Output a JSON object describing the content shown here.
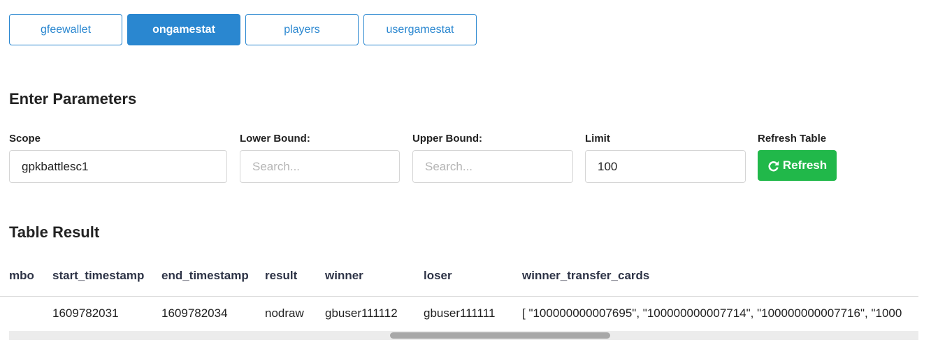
{
  "tabs": [
    {
      "label": "gfeewallet",
      "active": false
    },
    {
      "label": "ongamestat",
      "active": true
    },
    {
      "label": "players",
      "active": false
    },
    {
      "label": "usergamestat",
      "active": false
    }
  ],
  "params": {
    "title": "Enter Parameters",
    "scope": {
      "label": "Scope",
      "value": "gpkbattlesc1"
    },
    "lower_bound": {
      "label": "Lower Bound:",
      "placeholder": "Search..."
    },
    "upper_bound": {
      "label": "Upper Bound:",
      "placeholder": "Search..."
    },
    "limit": {
      "label": "Limit",
      "value": "100"
    },
    "refresh": {
      "label": "Refresh Table",
      "button": "Refresh"
    }
  },
  "result": {
    "title": "Table Result",
    "columns": [
      "mbo",
      "start_timestamp",
      "end_timestamp",
      "result",
      "winner",
      "loser",
      "winner_transfer_cards"
    ],
    "rows": [
      {
        "mbo": "",
        "start_timestamp": "1609782031",
        "end_timestamp": "1609782034",
        "result": "nodraw",
        "winner": "gbuser111112",
        "loser": "gbuser111111",
        "winner_transfer_cards": "[ \"100000000007695\", \"100000000007714\", \"100000000007716\", \"1000"
      }
    ]
  }
}
